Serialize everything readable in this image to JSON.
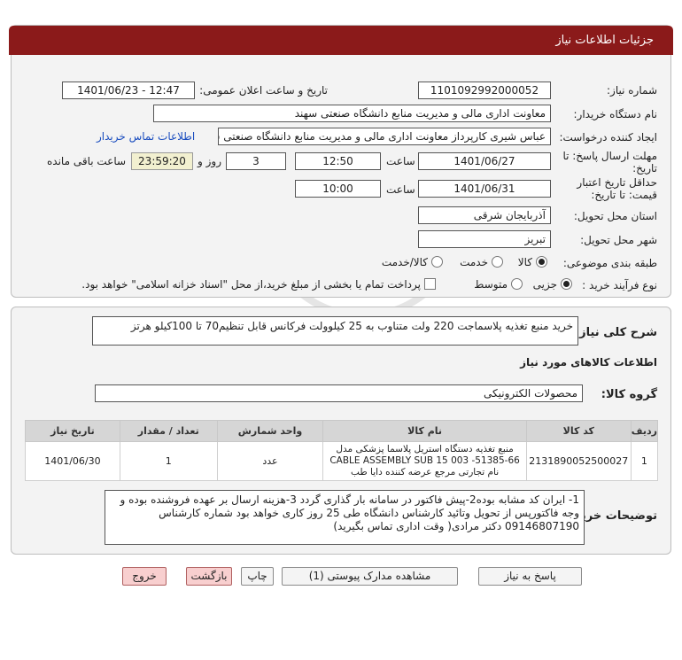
{
  "header": {
    "title": "جزئیات اطلاعات نیاز"
  },
  "watermark": {
    "logo_lines": [
      "0101",
      "001",
      "10"
    ],
    "brand": "ParsNamadData",
    "fa_line1": "پایگاه اطلاع رسانی مناقصه ایران",
    "fa_line2": "فراخوان پارس نماد داده ها",
    "phone": "۰۲۱-۸۸۳۴۹۶۷۰"
  },
  "form": {
    "need_number": {
      "label": "شماره نیاز:",
      "value": "1101092992000052"
    },
    "announce": {
      "label": "تاریخ و ساعت اعلان عمومی:",
      "value": "1401/06/23 - 12:47"
    },
    "buyer_org": {
      "label": "نام دستگاه خریدار:",
      "value": "معاونت اداری  مالی و مدیریت منابع دانشگاه صنعتی سهند"
    },
    "requester": {
      "label": "ایجاد کننده درخواست:",
      "value": "عباس شیری کارپرداز معاونت اداری  مالی و مدیریت منابع دانشگاه صنعتی سهند",
      "contact_link": "اطلاعات تماس خریدار"
    },
    "reply_deadline": {
      "label1": "مهلت ارسال پاسخ: تا",
      "label2": "تاریخ:",
      "date": "1401/06/27",
      "time_label": "ساعت",
      "time": "12:50",
      "days": "3",
      "days_label": "روز و",
      "remaining": "23:59:20",
      "remaining_label": "ساعت باقی مانده"
    },
    "price_validity": {
      "label1": "حداقل تاریخ اعتبار",
      "label2": "قیمت: تا تاریخ:",
      "date": "1401/06/31",
      "time_label": "ساعت",
      "time": "10:00"
    },
    "province": {
      "label": "استان محل تحویل:",
      "value": "آذربایجان شرقی"
    },
    "city": {
      "label": "شهر محل تحویل:",
      "value": "تبریز"
    },
    "category": {
      "label": "طبقه بندی موضوعی:",
      "options": [
        "کالا",
        "خدمت",
        "کالا/خدمت"
      ],
      "selected": "کالا"
    },
    "process": {
      "label": "نوع فرآیند خرید :",
      "options": [
        "جزیی",
        "متوسط"
      ],
      "selected": "جزیی",
      "payment_note": "پرداخت تمام یا بخشی از مبلغ خرید،از محل \"اسناد خزانه اسلامی\" خواهد بود."
    }
  },
  "summary": {
    "label": "شرح کلی نیاز:",
    "value": "خرید منبع تغذیه پلاسماجت 220 ولت متناوب به 25 کیلوولت فرکانس قابل تنظیم70 تا 100کیلو هرتز"
  },
  "goods_section": {
    "title": "اطلاعات کالاهای مورد نیاز",
    "group_label": "گروه کالا:",
    "group_value": "محصولات الکترونیکی",
    "columns": [
      "ردیف",
      "کد کالا",
      "نام کالا",
      "واحد شمارش",
      "تعداد / مقدار",
      "تاریخ نیاز"
    ],
    "rows": [
      {
        "index": "1",
        "code": "2131890052500027",
        "name": "منبع تغذیه دستگاه استریل پلاسما پزشکی مدل 66-51385- CABLE ASSEMBLY SUB 15 003 نام تجارتی مرجع عرضه کننده دایا طب",
        "unit": "عدد",
        "qty": "1",
        "date": "1401/06/30"
      }
    ]
  },
  "buyer_notes": {
    "label": "توضیحات خریدار:",
    "value": "1- ایران کد مشابه بوده2-پیش فاکتور در سامانه بار گذاری گردد 3-هزینه ارسال بر عهده فروشنده بوده و وجه فاکتورپس از تحویل وتائید کارشناس دانشگاه طی 25 روز کاری خواهد بود شماره کارشناس 09146807190 دکتر مرادی( وقت اداری تماس بگیرید)"
  },
  "buttons": {
    "reply": "پاسخ به نیاز",
    "attachments": "مشاهده مدارک پیوستی (1)",
    "print": "چاپ",
    "back": "بازگشت",
    "exit": "خروج"
  }
}
